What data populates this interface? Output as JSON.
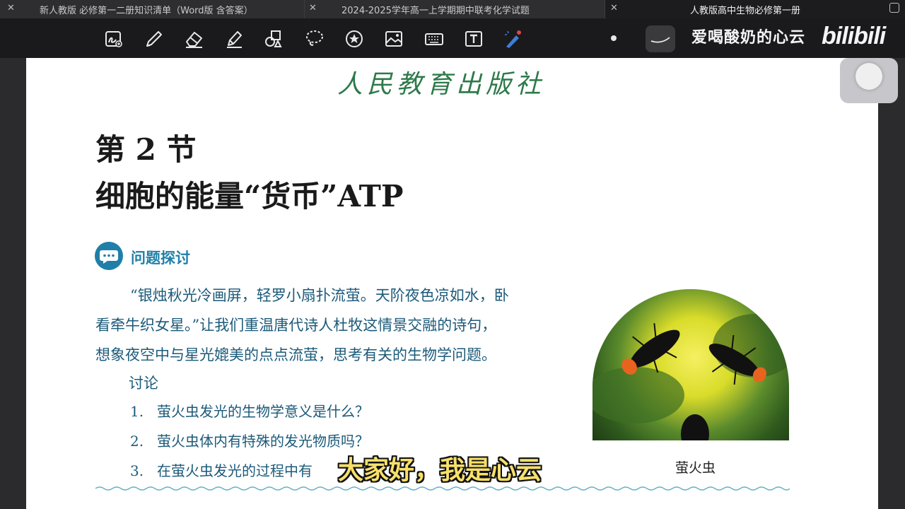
{
  "tabs": [
    {
      "title": "新人教版 必修第一二册知识清单（Word版 含答案）"
    },
    {
      "title": "2024-2025学年高一上学期期中联考化学试题"
    },
    {
      "title": "人教版高中生物必修第一册"
    }
  ],
  "toolbar": {
    "tools": [
      "lasso-text-icon",
      "pen-icon",
      "eraser-icon",
      "highlighter-icon",
      "shapes-icon",
      "lasso-icon",
      "sticker-icon",
      "image-icon",
      "keyboard-icon",
      "text-box-icon",
      "laser-pointer-icon"
    ]
  },
  "watermark": {
    "name": "爱喝酸奶的心云",
    "logo": "bilibili"
  },
  "page": {
    "publisher": "人民教育出版社",
    "section_number": "第 2 节",
    "section_title": "细胞的能量“货币”ATP",
    "question_heading": "问题探讨",
    "paragraph_lines": [
      "“银烛秋光冷画屏，轻罗小扇扑流萤。天阶夜色凉如水，卧",
      "看牵牛织女星。”让我们重温唐代诗人杜牧这情景交融的诗句，",
      "想象夜空中与星光媲美的点点流萤，思考有关的生物学问题。"
    ],
    "discuss_label": "讨论",
    "items": [
      {
        "num": "1.",
        "text": "萤火虫发光的生物学意义是什么？"
      },
      {
        "num": "2.",
        "text": "萤火虫体内有特殊的发光物质吗？"
      },
      {
        "num": "3.",
        "text": "在萤火虫发光的过程中有"
      }
    ],
    "image_caption": "萤火虫"
  },
  "subtitle": "大家好，我是心云",
  "colors": {
    "accent_blue": "#1f7fa8",
    "publisher_green": "#2d7a4a",
    "subtitle_yellow": "#f7e06a"
  }
}
